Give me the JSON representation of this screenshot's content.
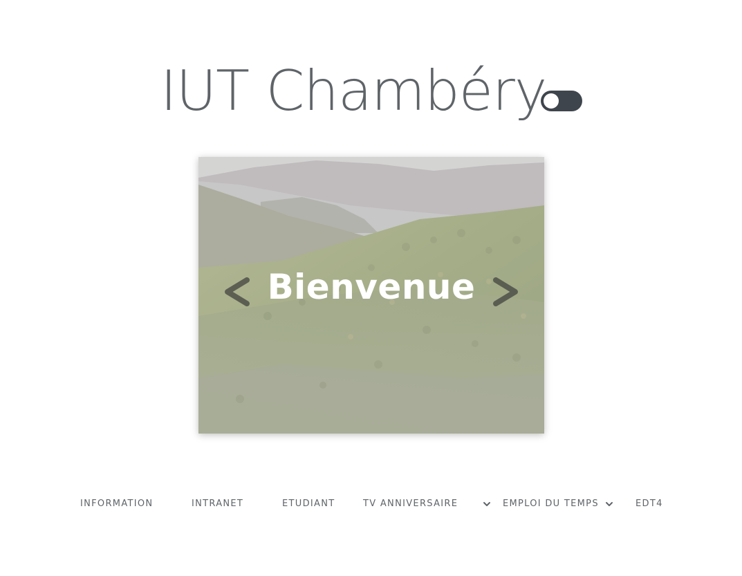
{
  "header": {
    "title": "IUT Chambéry",
    "theme_toggle_state": "on"
  },
  "slider": {
    "caption": "Bienvenue",
    "prev_label": "<",
    "next_label": ">",
    "image_icon": "mountain-forest-photo"
  },
  "nav": {
    "items": [
      {
        "label": "INFORMATION"
      },
      {
        "label": "INTRANET"
      },
      {
        "label": "ETUDIANT"
      },
      {
        "label": "TV ANNIVERSAIRE"
      },
      {
        "label": "EMPLOI DU TEMPS"
      },
      {
        "label": "EDT4"
      }
    ],
    "dropdown_icon": "chevron-down-icon"
  },
  "colors": {
    "text": "#5f6468",
    "toggle": "#3f454d",
    "background": "#ffffff"
  }
}
